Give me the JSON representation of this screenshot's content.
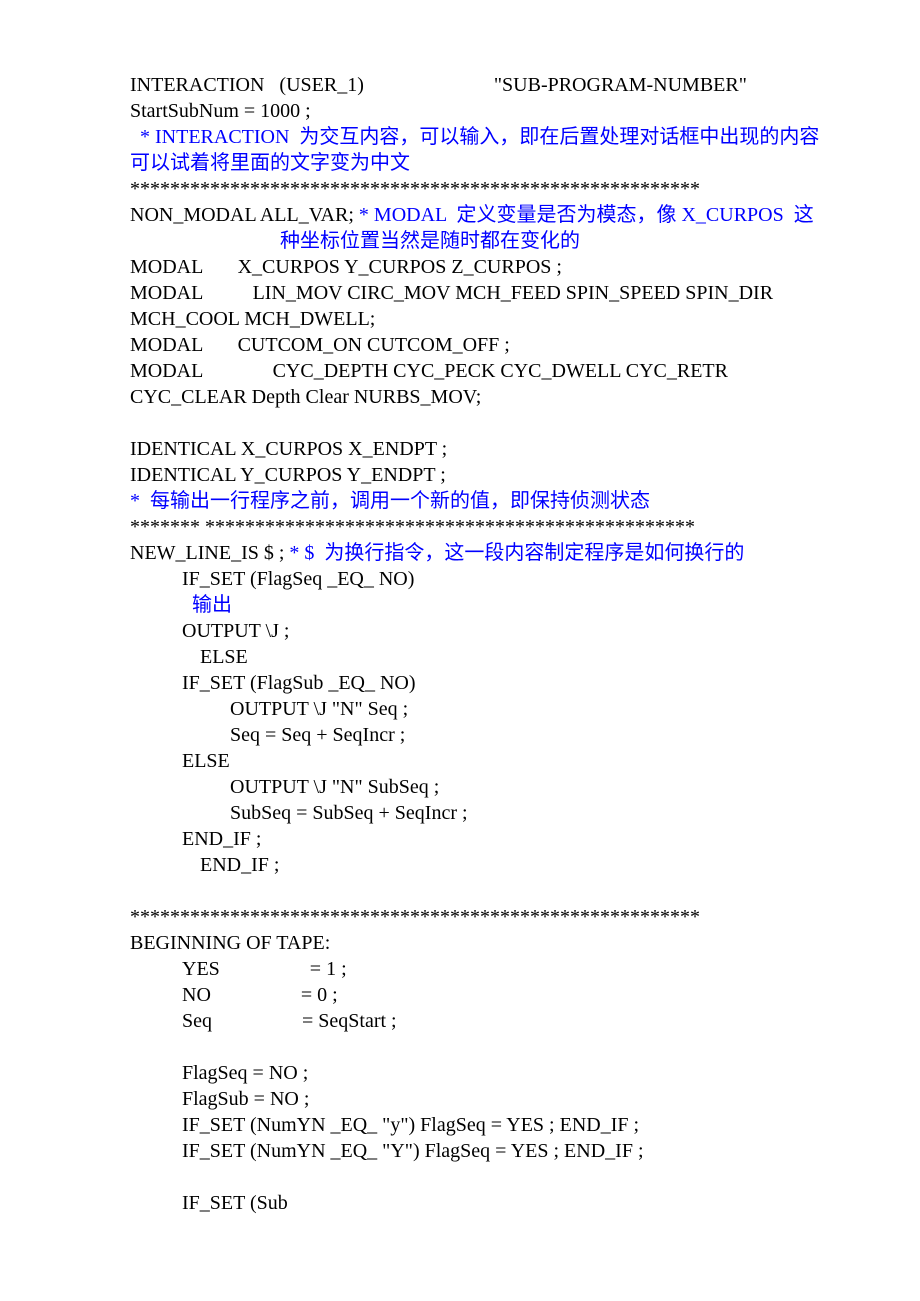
{
  "lines": [
    {
      "t": "INTERACTION   (USER_1)                          \"SUB-PROGRAM-NUMBER\"",
      "c": "",
      "i": 0
    },
    {
      "t": "StartSubNum = 1000 ;",
      "c": "",
      "i": 0
    },
    {
      "t": "  * INTERACTION  为交互内容，可以输入，即在后置处理对话框中出现的内容",
      "c": "blue",
      "i": 0
    },
    {
      "t": "可以试着将里面的文字变为中文",
      "c": "blue",
      "i": 0
    },
    {
      "t": "*********************************************************",
      "c": "",
      "i": 0
    },
    {
      "t": "",
      "c": "",
      "i": 0,
      "mixed": [
        {
          "t": "NON_MODAL ALL_VAR; ",
          "c": ""
        },
        {
          "t": "* MODAL  定义变量是否为模态，像 X_CURPOS  这",
          "c": "blue"
        }
      ]
    },
    {
      "t": "                              种坐标位置当然是随时都在变化的",
      "c": "blue",
      "i": 0
    },
    {
      "t": "MODAL       X_CURPOS Y_CURPOS Z_CURPOS ;",
      "c": "",
      "i": 0
    },
    {
      "t": "MODAL          LIN_MOV CIRC_MOV MCH_FEED SPIN_SPEED SPIN_DIR",
      "c": "",
      "i": 0
    },
    {
      "t": "MCH_COOL MCH_DWELL;",
      "c": "",
      "i": 0
    },
    {
      "t": "MODAL       CUTCOM_ON CUTCOM_OFF ;",
      "c": "",
      "i": 0
    },
    {
      "t": "MODAL              CYC_DEPTH CYC_PECK CYC_DWELL CYC_RETR",
      "c": "",
      "i": 0
    },
    {
      "t": "CYC_CLEAR Depth Clear NURBS_MOV;",
      "c": "",
      "i": 0
    },
    {
      "t": "",
      "c": "",
      "i": 0
    },
    {
      "t": "IDENTICAL X_CURPOS X_ENDPT ;",
      "c": "",
      "i": 0
    },
    {
      "t": "IDENTICAL Y_CURPOS Y_ENDPT ;",
      "c": "",
      "i": 0
    },
    {
      "t": "*  每输出一行程序之前，调用一个新的值，即保持侦测状态",
      "c": "blue",
      "i": 0
    },
    {
      "t": "******* *************************************************",
      "c": "",
      "i": 0
    },
    {
      "t": "",
      "c": "",
      "i": 0,
      "mixed": [
        {
          "t": "NEW_LINE_IS $ ; ",
          "c": ""
        },
        {
          "t": "* $  为换行指令，这一段内容制定程序是如何换行的",
          "c": "blue"
        }
      ]
    },
    {
      "t": "IF_SET (FlagSeq _EQ_ NO)",
      "c": "",
      "i": 1
    },
    {
      "t": "  输出",
      "c": "blue",
      "i": 1
    },
    {
      "t": "OUTPUT \\J ;",
      "c": "",
      "i": 1
    },
    {
      "t": "ELSE",
      "c": "",
      "i": 2
    },
    {
      "t": "IF_SET (FlagSub _EQ_ NO)",
      "c": "",
      "i": 1
    },
    {
      "t": "OUTPUT \\J \"N\" Seq ;",
      "c": "",
      "i": 3
    },
    {
      "t": "Seq = Seq + SeqIncr ;",
      "c": "",
      "i": 3
    },
    {
      "t": "ELSE",
      "c": "",
      "i": 1
    },
    {
      "t": "OUTPUT \\J \"N\" SubSeq ;",
      "c": "",
      "i": 3
    },
    {
      "t": "SubSeq = SubSeq + SeqIncr ;",
      "c": "",
      "i": 3
    },
    {
      "t": "END_IF ;",
      "c": "",
      "i": 1
    },
    {
      "t": "END_IF ;",
      "c": "",
      "i": 2
    },
    {
      "t": "",
      "c": "",
      "i": 0
    },
    {
      "t": "*********************************************************",
      "c": "",
      "i": 0
    },
    {
      "t": "BEGINNING OF TAPE:",
      "c": "",
      "i": 0
    },
    {
      "t": "YES                  = 1 ;",
      "c": "",
      "i": 1
    },
    {
      "t": "NO                  = 0 ;",
      "c": "",
      "i": 1
    },
    {
      "t": "Seq                  = SeqStart ;",
      "c": "",
      "i": 1
    },
    {
      "t": "",
      "c": "",
      "i": 0
    },
    {
      "t": "FlagSeq = NO ;",
      "c": "",
      "i": 1
    },
    {
      "t": "FlagSub = NO ;",
      "c": "",
      "i": 1
    },
    {
      "t": "IF_SET (NumYN _EQ_ \"y\") FlagSeq = YES ; END_IF ;",
      "c": "",
      "i": 1
    },
    {
      "t": "IF_SET (NumYN _EQ_ \"Y\") FlagSeq = YES ; END_IF ;",
      "c": "",
      "i": 1
    },
    {
      "t": "",
      "c": "",
      "i": 0
    },
    {
      "t": "IF_SET (Sub",
      "c": "",
      "i": 1
    }
  ]
}
